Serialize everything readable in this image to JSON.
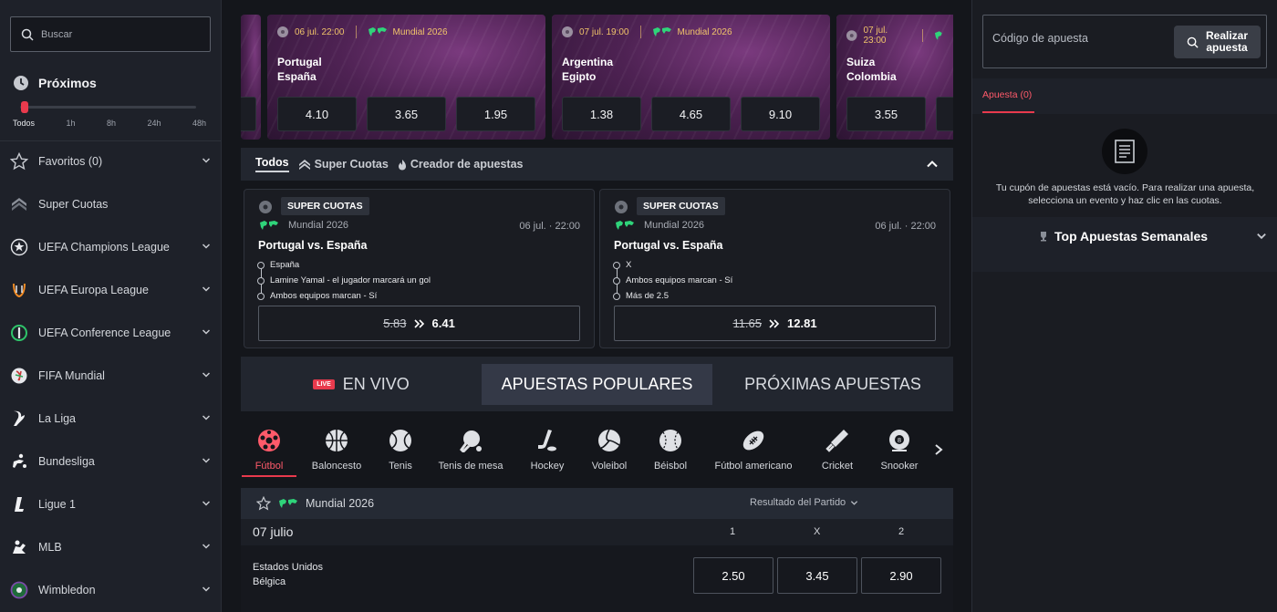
{
  "sidebar": {
    "search_placeholder": "Buscar",
    "proximos_title": "Próximos",
    "time_filters": [
      "Todos",
      "1h",
      "8h",
      "24h",
      "48h"
    ],
    "items": [
      {
        "label": "Favoritos (0)",
        "icon": "star-icon",
        "chevron": true
      },
      {
        "label": "Super Cuotas",
        "icon": "super-cuotas-icon",
        "chevron": false
      },
      {
        "label": "UEFA Champions League",
        "icon": "champions-league-icon",
        "chevron": true
      },
      {
        "label": "UEFA Europa League",
        "icon": "europa-league-icon",
        "chevron": true
      },
      {
        "label": "UEFA Conference League",
        "icon": "conference-league-icon",
        "chevron": true
      },
      {
        "label": "FIFA Mundial",
        "icon": "fifa-mundial-icon",
        "chevron": true
      },
      {
        "label": "La Liga",
        "icon": "la-liga-icon",
        "chevron": true
      },
      {
        "label": "Bundesliga",
        "icon": "bundesliga-icon",
        "chevron": true
      },
      {
        "label": "Ligue 1",
        "icon": "ligue-1-icon",
        "chevron": true
      },
      {
        "label": "MLB",
        "icon": "mlb-icon",
        "chevron": true
      },
      {
        "label": "Wimbledon",
        "icon": "wimbledon-icon",
        "chevron": true
      }
    ]
  },
  "banners": [
    {
      "date": "06 jul. 22:00",
      "league": "Mundial 2026",
      "team1": "Portugal",
      "team2": "España",
      "odds": [
        "4.10",
        "3.65",
        "1.95"
      ]
    },
    {
      "date": "07 jul. 19:00",
      "league": "Mundial 2026",
      "team1": "Argentina",
      "team2": "Egipto",
      "odds": [
        "1.38",
        "4.65",
        "9.10"
      ]
    },
    {
      "date": "07 jul. 23:00",
      "league": "",
      "team1": "Suiza",
      "team2": "Colombia",
      "odds": [
        "3.55"
      ]
    }
  ],
  "filters": {
    "todos": "Todos",
    "super_cuotas": "Super Cuotas",
    "creador": "Creador de apuestas"
  },
  "super_cuotas_cards": [
    {
      "badge": "SUPER CUOTAS",
      "league": "Mundial 2026",
      "date": "06 jul. · 22:00",
      "match": "Portugal vs. España",
      "legs": [
        "España",
        "Lamine Yamal - el jugador marcará un gol",
        "Ambos equipos marcan - Sí"
      ],
      "old_odds": "5.83",
      "new_odds": "6.41"
    },
    {
      "badge": "SUPER CUOTAS",
      "league": "Mundial 2026",
      "date": "06 jul. · 22:00",
      "match": "Portugal vs. España",
      "legs": [
        "X",
        "Ambos equipos marcan - Sí",
        "Más de 2.5"
      ],
      "old_odds": "11.65",
      "new_odds": "12.81"
    }
  ],
  "main_tabs": {
    "live_badge": "LIVE",
    "en_vivo": "EN VIVO",
    "populares": "APUESTAS POPULARES",
    "proximas": "PRÓXIMAS APUESTAS"
  },
  "sports": [
    "Fútbol",
    "Baloncesto",
    "Tenis",
    "Tenis de mesa",
    "Hockey",
    "Voleibol",
    "Béisbol",
    "Fútbol americano",
    "Cricket",
    "Snooker"
  ],
  "event_list": {
    "league": "Mundial 2026",
    "market": "Resultado del Partido",
    "date": "07 julio",
    "cols": [
      "1",
      "X",
      "2"
    ],
    "match": {
      "team1": "Estados Unidos",
      "team2": "Bélgica",
      "odds": [
        "2.50",
        "3.45",
        "2.90"
      ]
    }
  },
  "betslip": {
    "code_placeholder": "Código de apuesta",
    "realizar_line1": "Realizar",
    "realizar_line2": "apuesta",
    "tab": "Apuesta (0)",
    "empty_text": "Tu cupón de apuestas está vacío. Para realizar una apuesta, selecciona un evento y haz clic en las cuotas.",
    "top_title": "Top Apuestas Semanales"
  },
  "colors": {
    "accent": "#e83a4d",
    "gold": "#f0c36a",
    "background": "#14161b",
    "panel": "#1e2129"
  }
}
